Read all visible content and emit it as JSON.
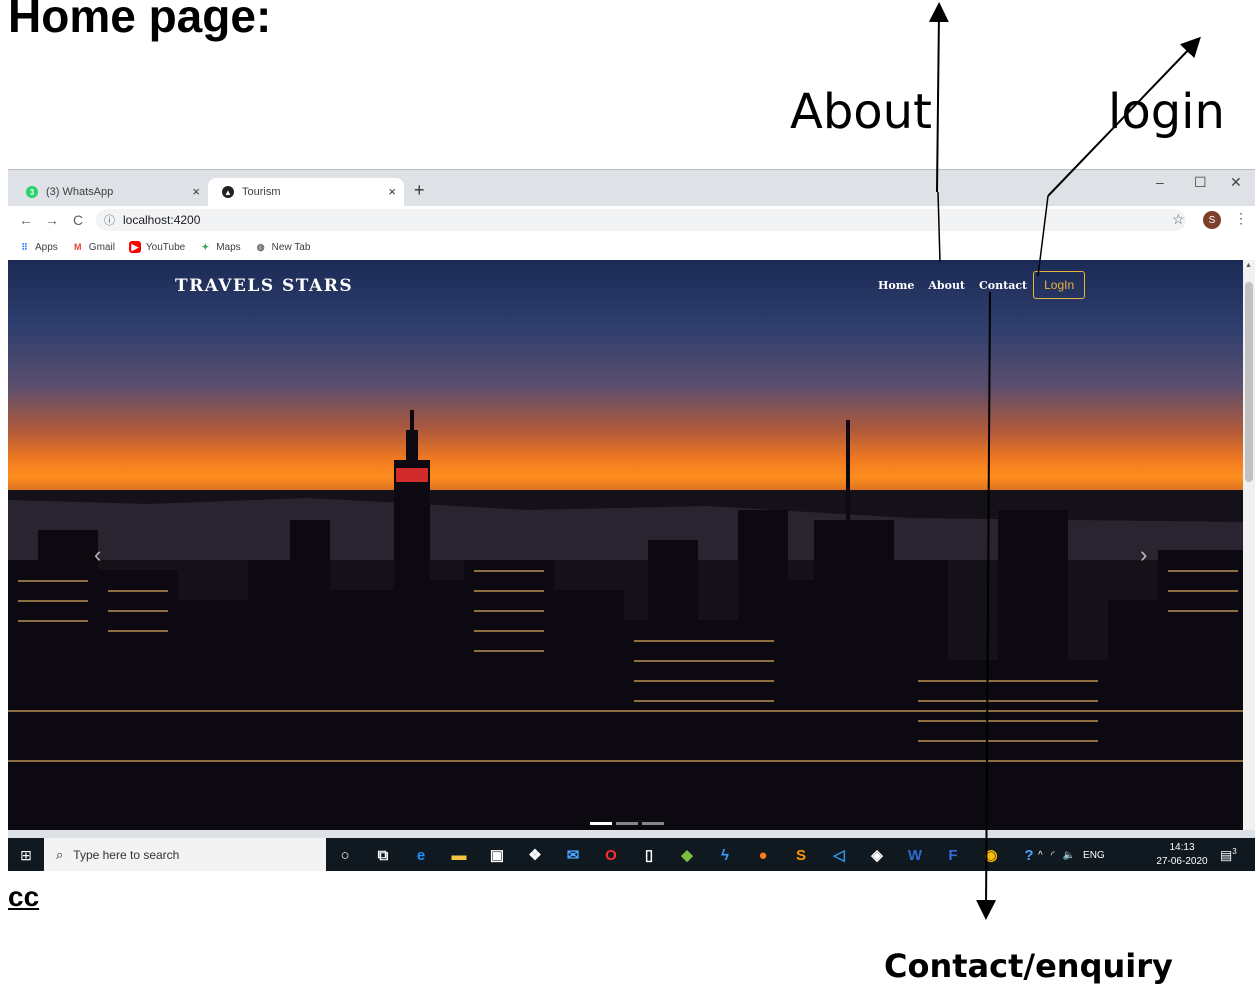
{
  "doc": {
    "heading": "Home page:",
    "annotations": {
      "about": "About",
      "login": "login",
      "contact": "Contact/enquiry",
      "cc": "cc"
    }
  },
  "browser": {
    "tabs": [
      {
        "title": "(3) WhatsApp",
        "badge": "3",
        "icon": "whatsapp-icon",
        "close": "×"
      },
      {
        "title": "Tourism",
        "icon": "angular-icon",
        "close": "×"
      }
    ],
    "new_tab": "+",
    "window_controls": {
      "minimize": "–",
      "maximize": "☐",
      "close": "✕"
    },
    "nav": {
      "back": "←",
      "forward": "→",
      "reload": "C"
    },
    "url": "localhost:4200",
    "url_icon": "ⓘ",
    "star": "☆",
    "profile_initial": "S",
    "menu": "⋮",
    "bookmarks": [
      {
        "label": "Apps",
        "icon": "apps-grid-icon",
        "glyph": "⋮⋮⋮"
      },
      {
        "label": "Gmail",
        "icon": "gmail-icon",
        "glyph": "M"
      },
      {
        "label": "YouTube",
        "icon": "youtube-icon",
        "glyph": "▶"
      },
      {
        "label": "Maps",
        "icon": "maps-icon",
        "glyph": "✦"
      },
      {
        "label": "New Tab",
        "icon": "globe-icon",
        "glyph": "◍"
      }
    ]
  },
  "site": {
    "brand": "TRAVELS STARS",
    "nav": [
      {
        "label": "Home"
      },
      {
        "label": "About"
      },
      {
        "label": "Contact"
      }
    ],
    "login": "LogIn",
    "carousel": {
      "prev": "‹",
      "next": "›"
    }
  },
  "taskbar": {
    "start": "⊞",
    "search_placeholder": "Type here to search",
    "search_icon": "⌕",
    "apps": [
      {
        "name": "cortana-icon",
        "glyph": "○",
        "color": "#ffffff"
      },
      {
        "name": "task-view-icon",
        "glyph": "⧉",
        "color": "#ffffff"
      },
      {
        "name": "edge-icon",
        "glyph": "e",
        "color": "#1e90ff"
      },
      {
        "name": "file-explorer-icon",
        "glyph": "▬",
        "color": "#f5c542"
      },
      {
        "name": "store-icon",
        "glyph": "▣",
        "color": "#ffffff"
      },
      {
        "name": "dropbox-icon",
        "glyph": "❖",
        "color": "#ffffff"
      },
      {
        "name": "mail-icon",
        "glyph": "✉",
        "color": "#4aa3ff"
      },
      {
        "name": "opera-icon",
        "glyph": "O",
        "color": "#ff2d2d"
      },
      {
        "name": "notepad-icon",
        "glyph": "▯",
        "color": "#ffffff"
      },
      {
        "name": "android-studio-icon",
        "glyph": "◆",
        "color": "#7cc043"
      },
      {
        "name": "power-bi-icon",
        "glyph": "ϟ",
        "color": "#3b9cff"
      },
      {
        "name": "firefox-icon",
        "glyph": "●",
        "color": "#ff7a1a"
      },
      {
        "name": "sublime-icon",
        "glyph": "S",
        "color": "#ff9800"
      },
      {
        "name": "vscode-icon",
        "glyph": "◁",
        "color": "#2f9bf0"
      },
      {
        "name": "git-icon",
        "glyph": "◈",
        "color": "#ffffff"
      },
      {
        "name": "word-icon",
        "glyph": "W",
        "color": "#2b6cd1"
      },
      {
        "name": "app-f-icon",
        "glyph": "F",
        "color": "#3a6bdc"
      },
      {
        "name": "chrome-icon",
        "glyph": "◉",
        "color": "#fbbc05"
      },
      {
        "name": "help-icon",
        "glyph": "?",
        "color": "#4aa3ff"
      }
    ],
    "tray": {
      "chevron": "^",
      "wifi": "◜",
      "volume": "🔈",
      "lang": "ENG"
    },
    "time": "14:13",
    "date": "27-06-2020",
    "notifications": "▤",
    "notification_count": "3"
  }
}
